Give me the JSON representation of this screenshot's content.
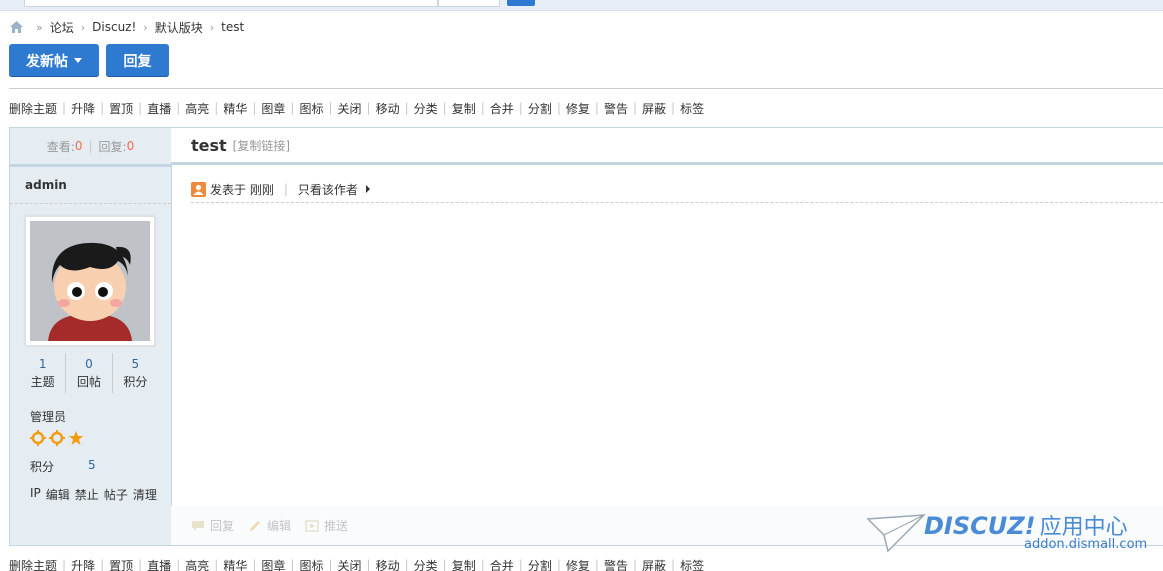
{
  "breadcrumb": {
    "items": [
      "论坛",
      "Discuz!",
      "默认版块",
      "test"
    ]
  },
  "buttons": {
    "new_post": "发新帖",
    "reply": "回复"
  },
  "mod_actions": [
    "删除主题",
    "升降",
    "置顶",
    "直播",
    "高亮",
    "精华",
    "图章",
    "图标",
    "关闭",
    "移动",
    "分类",
    "复制",
    "合并",
    "分割",
    "修复",
    "警告",
    "屏蔽",
    "标签"
  ],
  "thread_stats": {
    "views_label": "查看:",
    "views": "0",
    "replies_label": "回复:",
    "replies": "0"
  },
  "thread": {
    "title": "test",
    "copy_link": "[复制链接]"
  },
  "post_meta": {
    "posted": "发表于 刚刚",
    "only_author": "只看该作者"
  },
  "author": {
    "name": "admin",
    "stats": [
      {
        "value": "1",
        "label": "主题"
      },
      {
        "value": "0",
        "label": "回帖"
      },
      {
        "value": "5",
        "label": "积分"
      }
    ],
    "group": "管理员",
    "credits_label": "积分",
    "credits_value": "5",
    "admin_links": [
      "IP",
      "编辑",
      "禁止",
      "帖子",
      "清理"
    ]
  },
  "post_footer": {
    "reply": "回复",
    "edit": "编辑",
    "push": "推送"
  },
  "watermark": {
    "brand": "DISCUZ!",
    "brand_cn": "应用中心",
    "url": "addon.dismall.com"
  },
  "colors": {
    "accent": "#2f7ad1",
    "panel_bg": "#e5edf2",
    "panel_border": "#c2d5e3",
    "stat_number": "#f26c4f",
    "star": "#f39c12"
  }
}
